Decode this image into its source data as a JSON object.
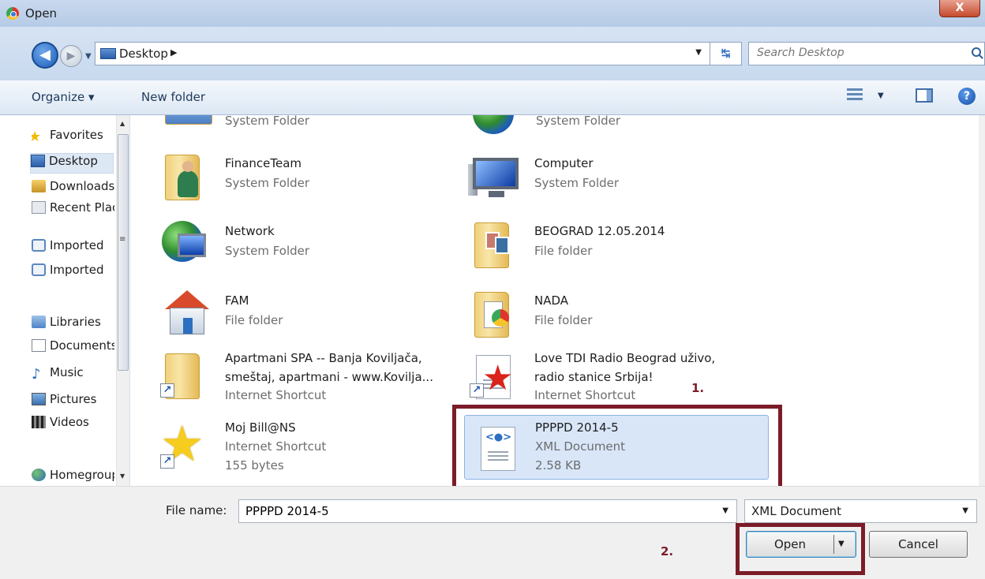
{
  "window": {
    "title": "Open",
    "close_label": "X"
  },
  "address": {
    "location": "Desktop",
    "search_placeholder": "Search Desktop"
  },
  "toolbar": {
    "organize_label": "Organize ▾",
    "new_folder_label": "New folder"
  },
  "nav": {
    "items": [
      {
        "label": "Favorites",
        "icon": "star-icon"
      },
      {
        "label": "Desktop",
        "icon": "desktop-icon",
        "selected": true
      },
      {
        "label": "Downloads",
        "icon": "downloads-icon"
      },
      {
        "label": "Recent Places",
        "icon": "recent-places-icon"
      },
      {
        "label": "Imported",
        "icon": "imported-icon"
      },
      {
        "label": "Imported",
        "icon": "imported-icon"
      },
      {
        "label": "Libraries",
        "icon": "libraries-icon"
      },
      {
        "label": "Documents",
        "icon": "documents-icon"
      },
      {
        "label": "Music",
        "icon": "music-icon"
      },
      {
        "label": "Pictures",
        "icon": "pictures-icon"
      },
      {
        "label": "Videos",
        "icon": "videos-icon"
      },
      {
        "label": "Homegroup",
        "icon": "homegroup-icon"
      }
    ]
  },
  "files": [
    {
      "name": "",
      "type": "System Folder",
      "icon": "partial-folder-icon"
    },
    {
      "name": "",
      "type": "System Folder",
      "icon": "partial-globe-icon"
    },
    {
      "name": "FinanceTeam",
      "type": "System Folder",
      "icon": "user-folder-icon"
    },
    {
      "name": "Computer",
      "type": "System Folder",
      "icon": "computer-icon"
    },
    {
      "name": "Network",
      "type": "System Folder",
      "icon": "network-icon"
    },
    {
      "name": "BEOGRAD 12.05.2014",
      "type": "File folder",
      "icon": "photo-folder-icon"
    },
    {
      "name": "FAM",
      "type": "File folder",
      "icon": "home-icon"
    },
    {
      "name": "NADA",
      "type": "File folder",
      "icon": "document-folder-icon"
    },
    {
      "name": "Apartmani SPA -- Banja Koviljača,",
      "name2": "smeštaj, apartmani - www.Kovilja...",
      "type": "Internet Shortcut",
      "icon": "shortcut-folder-icon"
    },
    {
      "name": "Love TDI Radio Beograd uživo,",
      "name2": "radio stanice Srbija!",
      "type": "Internet Shortcut",
      "icon": "radio-shortcut-icon"
    },
    {
      "name": "Moj Bill@NS",
      "type": "Internet Shortcut",
      "size": "155 bytes",
      "icon": "star-shortcut-icon"
    },
    {
      "name": "PPPPD 2014-5",
      "type": "XML Document",
      "size": "2.58 KB",
      "icon": "xml-document-icon",
      "selected": true
    }
  ],
  "annotations": {
    "step1": "1.",
    "step2": "2."
  },
  "bottom": {
    "file_name_label": "File name:",
    "file_name_value": "PPPPD 2014-5",
    "file_type_value": "XML Document",
    "open_label": "Open",
    "cancel_label": "Cancel"
  },
  "colors": {
    "annotation": "#7b1c28",
    "selection": "#d8e6f8"
  }
}
